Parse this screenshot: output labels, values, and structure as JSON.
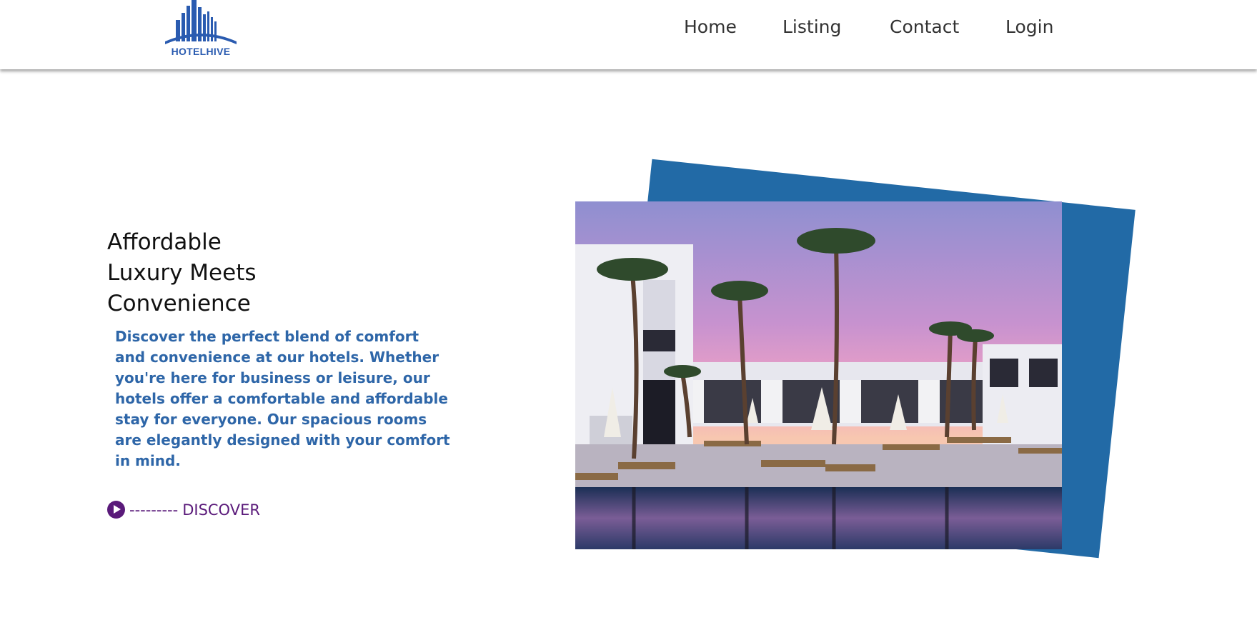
{
  "brand": {
    "name": "HOTELHIVE",
    "logo_icon": "building-skyline-icon",
    "color": "#2a5bb0"
  },
  "nav": {
    "items": [
      {
        "label": "Home"
      },
      {
        "label": "Listing"
      },
      {
        "label": "Contact"
      },
      {
        "label": "Login"
      }
    ]
  },
  "hero": {
    "title_lines": [
      "Affordable",
      "Luxury Meets",
      "Convenience"
    ],
    "description": "Discover the perfect blend of comfort and convenience at our hotels. Whether you're here for business or leisure, our hotels offer a comfortable and affordable stay for everyone. Our spacious rooms are elegantly designed with your comfort in mind.",
    "cta": {
      "icon": "play-circle-icon",
      "dashes": "---------",
      "label": "DISCOVER"
    }
  },
  "image": {
    "subject": "resort-pool-palm-trees-sunset-photo",
    "frame_color": "#226aa6"
  },
  "colors": {
    "text_dark": "#111111",
    "accent_blue": "#2e66a8",
    "accent_purple": "#5a1a7a"
  }
}
